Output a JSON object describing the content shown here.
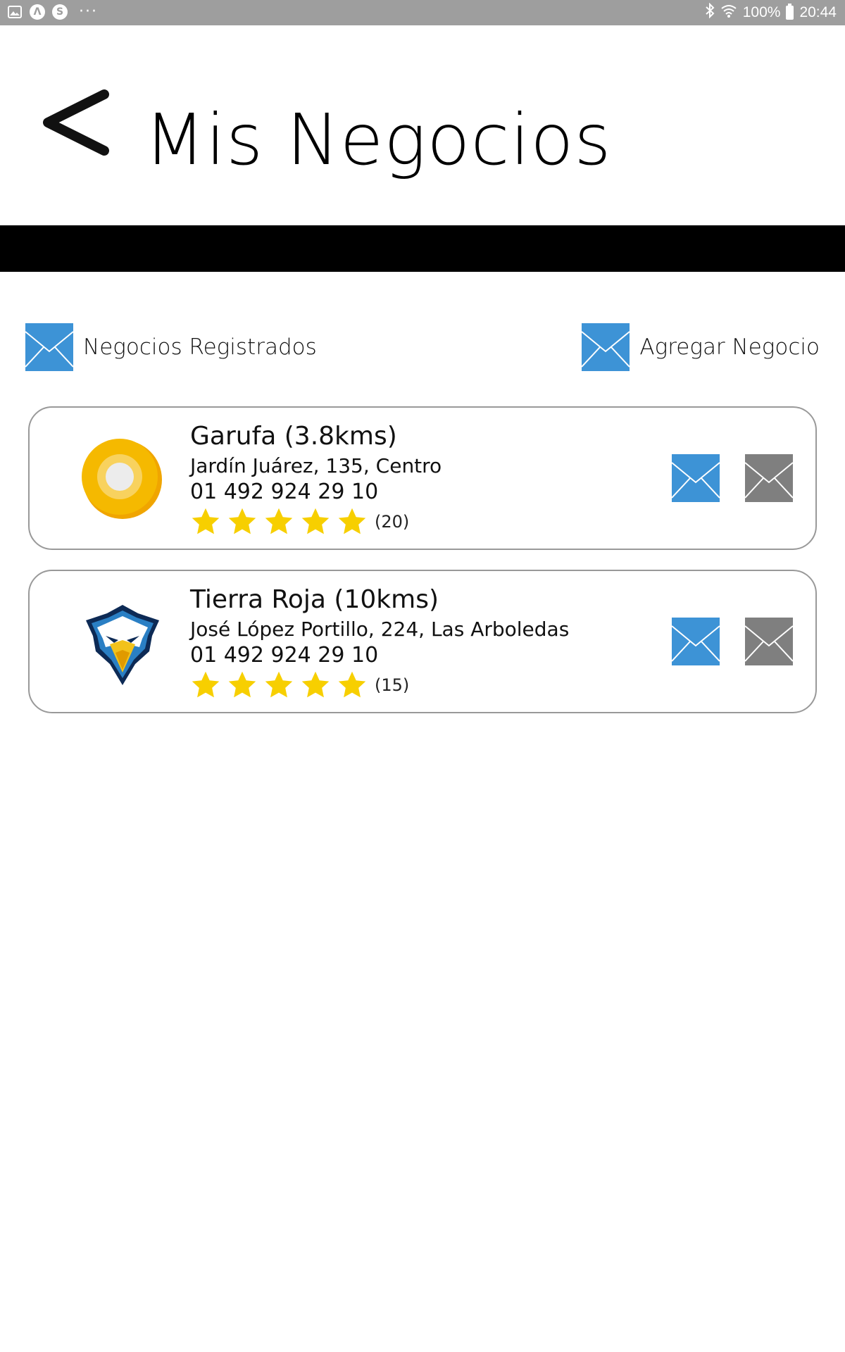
{
  "status_bar": {
    "left_icons": [
      "image-icon",
      "a-icon",
      "s-icon"
    ],
    "more": "···",
    "bluetooth": "bluetooth-icon",
    "wifi": "wifi-icon",
    "battery_pct": "100%",
    "time": "20:44"
  },
  "header": {
    "back_icon": "chevron-left-icon",
    "title": "Mis Negocios"
  },
  "actions": {
    "registered_label": "Negocios Registrados",
    "add_label": "Agregar Negocio"
  },
  "colors": {
    "accent_blue": "#3d93d6",
    "gray_button": "#7f7f7f",
    "star": "#f7cf00",
    "band": "#000000",
    "status_bar": "#9e9e9e"
  },
  "businesses": [
    {
      "name": "Garufa (3.8kms)",
      "address": "Jardín Juárez, 135, Centro",
      "phone": "01 492 924 29 10",
      "rating": 5,
      "reviews": "(20)",
      "logo": "android-o-logo"
    },
    {
      "name": "Tierra Roja (10kms)",
      "address": "José López Portillo, 224, Las Arboledas",
      "phone": "01 492 924 29 10",
      "rating": 5,
      "reviews": "(15)",
      "logo": "eagle-logo"
    }
  ]
}
